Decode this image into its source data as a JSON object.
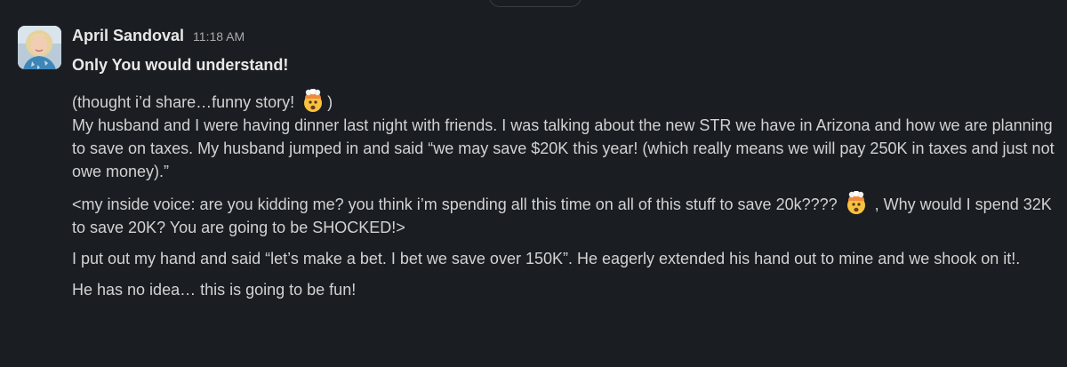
{
  "message": {
    "sender": "April Sandoval",
    "timestamp": "11:18 AM",
    "headline": "Only You would understand!",
    "p1_before_emoji": "(thought i’d share…funny story! ",
    "p1_after_emoji": ")",
    "p1_rest": "My husband and I were having dinner last night with friends.  I was talking about the new STR we have in Arizona and how we are planning to save on taxes. My husband jumped in and said “we may save $20K this year! (which really means we will pay 250K in taxes and just not owe money).”",
    "p2_before_emoji": "<my inside voice:  are you kidding me?  you think i’m spending all this time on all of this stuff to save 20k???? ",
    "p2_after_emoji": " , Why would I spend 32K to save 20K? You are going to be SHOCKED!>",
    "p3": "I put out my hand and said “let’s make a bet.  I bet we save over 150K”. He eagerly extended his hand out to mine and we shook on it!.",
    "p4": "He has no idea… this is going to be fun!",
    "emoji_name": "exploding-head",
    "colors": {
      "background": "#1a1d21",
      "text": "#d1d2d3",
      "sender": "#e8e8e8",
      "timestamp": "#ababad"
    }
  }
}
